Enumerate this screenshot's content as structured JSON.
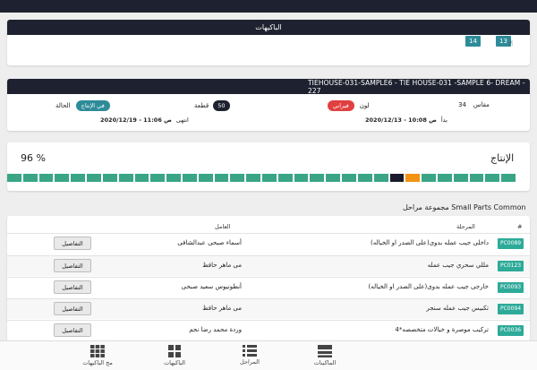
{
  "packages": {
    "title": "الباكيهات",
    "chips": [
      "14",
      "13"
    ]
  },
  "order": {
    "title": "TIEHOUSE-031-SAMPLE6 - TIE HOUSE-031 -SAMPLE 6- DREAM - 227",
    "size_label": "مقاس",
    "size_value": "34",
    "color_label": "لون",
    "color_value": "فيراني",
    "count_value": "50",
    "count_unit": "قطعة",
    "status_label": "الحالة",
    "status_value": "في الإنتاج",
    "start_label": "بدأ",
    "start_value": "2020/12/13 - 10:08 ص",
    "end_label": "انتهى",
    "end_value": "2020/12/19 - 11:06 ص",
    "colors": {
      "dark": "#1e2230",
      "teal": "#2e8b99",
      "red": "#e0403f"
    }
  },
  "production": {
    "title": "الإنتاج",
    "percent_text": "96 %",
    "percent": 96,
    "segments": [
      "done",
      "done",
      "done",
      "done",
      "done",
      "done",
      "done",
      "done",
      "done",
      "done",
      "done",
      "done",
      "done",
      "done",
      "done",
      "done",
      "done",
      "done",
      "done",
      "done",
      "done",
      "done",
      "done",
      "done",
      "dark",
      "orange",
      "done",
      "done",
      "done",
      "done",
      "done",
      "done"
    ],
    "segment_colors": {
      "done": "#3aa586",
      "orange": "#f39312",
      "dark": "#1a1a2e"
    }
  },
  "stages": {
    "title": "مجموعة مراحل Small Parts Common",
    "columns": {
      "num": "#",
      "stage": "المرحلة",
      "worker": "العامل"
    },
    "details_label": "التفاصيل",
    "rows": [
      {
        "code": "PC0089",
        "stage": "داخلى جيب عمله بدوى(على الصدر او الخياله)",
        "worker": "أسماء صبحى عبدالشافى"
      },
      {
        "code": "PC0123",
        "stage": "مللي سحري جيب عمله",
        "worker": "مى ماهر حافظ"
      },
      {
        "code": "PC0093",
        "stage": "خارجى جيب عمله بدوى(على الصدر او الخياله)",
        "worker": "أنطونيوس سعيد صبحى"
      },
      {
        "code": "PC0094",
        "stage": "تكبيس جيب عمله سنجر",
        "worker": "مى ماهر حافظ"
      },
      {
        "code": "PC0036",
        "stage": "تركيب موصرة و خيالات متخصصه*4",
        "worker": "وردة محمد رضا نجم"
      }
    ]
  },
  "nav": {
    "items": [
      {
        "label": "الماكينات",
        "icon": "machine-icon"
      },
      {
        "label": "المراحل",
        "icon": "list-icon"
      },
      {
        "label": "الباكيهات",
        "icon": "grid-icon"
      },
      {
        "label": "مج الباكيهات",
        "icon": "grid-group-icon"
      }
    ]
  }
}
